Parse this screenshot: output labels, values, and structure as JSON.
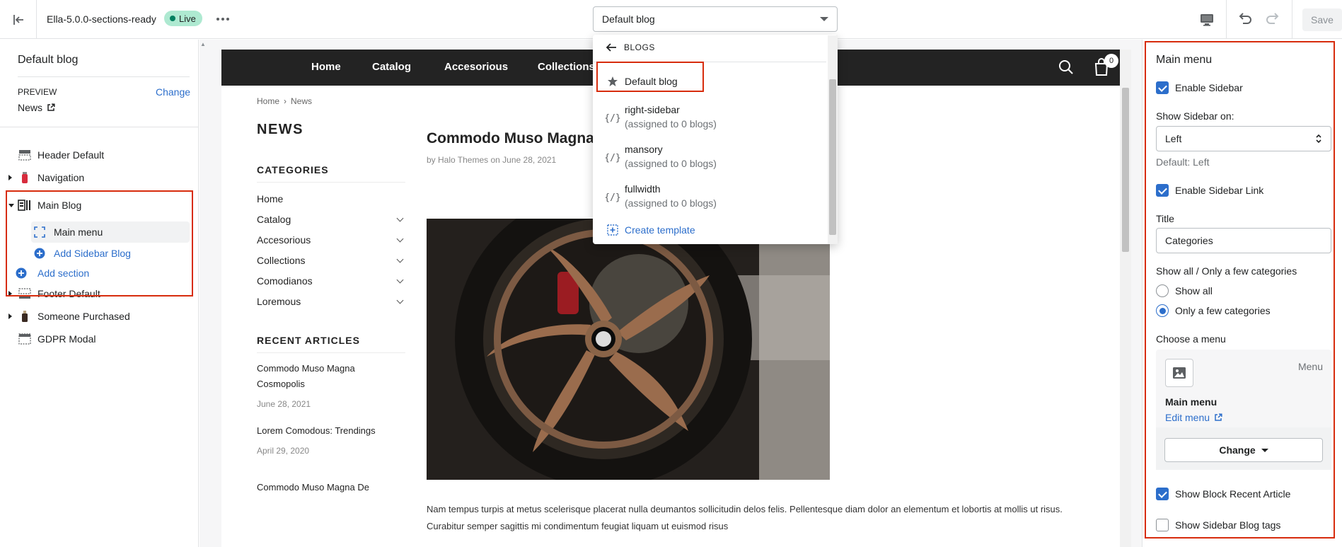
{
  "topbar": {
    "theme_name": "Ella-5.0.0-sections-ready",
    "live_label": "Live",
    "template_select": "Default blog",
    "save_label": "Save",
    "icons": {
      "exit": "exit-icon",
      "more": "more-horizontal-icon",
      "device": "desktop-icon",
      "undo": "undo-icon",
      "redo": "redo-icon"
    }
  },
  "left": {
    "title": "Default blog",
    "preview_label": "PREVIEW",
    "preview_change": "Change",
    "preview_value": "News",
    "sections": [
      {
        "label": "Header Default",
        "icon": "header-icon",
        "expandable": false
      },
      {
        "label": "Navigation",
        "icon": "navigation-icon",
        "expandable": true
      },
      {
        "label": "Main Blog",
        "icon": "blog-icon",
        "expandable": true,
        "expanded": true
      },
      {
        "label": "Footer Default",
        "icon": "footer-icon",
        "expandable": true
      },
      {
        "label": "Someone Purchased",
        "icon": "bottle-icon",
        "expandable": true
      },
      {
        "label": "GDPR Modal",
        "icon": "modal-icon",
        "expandable": false
      }
    ],
    "main_blog_children": {
      "main_menu": "Main menu",
      "add_sidebar_block": "Add Sidebar Blog",
      "add_section": "Add section"
    }
  },
  "store": {
    "nav": [
      "Home",
      "Catalog",
      "Accesorious",
      "Collections"
    ],
    "cart_count": "0",
    "breadcrumb": [
      "Home",
      "News"
    ],
    "page_heading": "NEWS",
    "categories_heading": "CATEGORIES",
    "categories": [
      {
        "label": "Home",
        "has_children": false
      },
      {
        "label": "Catalog",
        "has_children": true
      },
      {
        "label": "Accesorious",
        "has_children": true
      },
      {
        "label": "Collections",
        "has_children": true
      },
      {
        "label": "Comodianos",
        "has_children": true
      },
      {
        "label": "Loremous",
        "has_children": true
      }
    ],
    "recent_heading": "RECENT ARTICLES",
    "recent": [
      {
        "title": "Commodo Muso Magna Cosmopolis",
        "date": "June 28, 2021"
      },
      {
        "title": "Lorem Comodous: Trendings",
        "date": "April 29, 2020"
      },
      {
        "title": "Commodo Muso Magna De",
        "date": ""
      }
    ],
    "article": {
      "title": "Commodo Muso Magna C",
      "meta": "by Halo Themes on June 28, 2021",
      "body": "Nam tempus turpis at metus scelerisque placerat nulla deumantos sollicitudin delos felis. Pellentesque diam dolor an elementum et lobortis at mollis ut risus. Curabitur semper sagittis mi condimentum feugiat liquam ut euismod risus"
    }
  },
  "dropdown": {
    "back_label": "BLOGS",
    "items": [
      {
        "name": "Default blog",
        "sub": "",
        "icon": "star-icon"
      },
      {
        "name": "right-sidebar",
        "sub": "(assigned to 0 blogs)",
        "icon": "template-icon"
      },
      {
        "name": "mansory",
        "sub": "(assigned to 0 blogs)",
        "icon": "template-icon"
      },
      {
        "name": "fullwidth",
        "sub": "(assigned to 0 blogs)",
        "icon": "template-icon"
      }
    ],
    "create_label": "Create template"
  },
  "right": {
    "title": "Main menu",
    "enable_sidebar": {
      "label": "Enable Sidebar",
      "checked": true
    },
    "show_sidebar_on": {
      "label": "Show Sidebar on:",
      "value": "Left",
      "help": "Default: Left"
    },
    "enable_sidebar_link": {
      "label": "Enable Sidebar Link",
      "checked": true
    },
    "title_field": {
      "label": "Title",
      "value": "Categories"
    },
    "show_mode": {
      "label": "Show all / Only a few categories",
      "options": [
        "Show all",
        "Only a few categories"
      ],
      "selected": "Only a few categories"
    },
    "choose_menu": {
      "label": "Choose a menu",
      "type": "Menu",
      "name": "Main menu",
      "edit": "Edit menu",
      "change": "Change"
    },
    "show_recent": {
      "label": "Show Block Recent Article",
      "checked": true
    },
    "show_tags": {
      "label": "Show Sidebar Blog tags",
      "checked": false
    }
  },
  "colors": {
    "accent": "#2c6ecb",
    "highlight": "#d72c0d",
    "live_bg": "#aee9d1",
    "store_nav": "#232323"
  }
}
